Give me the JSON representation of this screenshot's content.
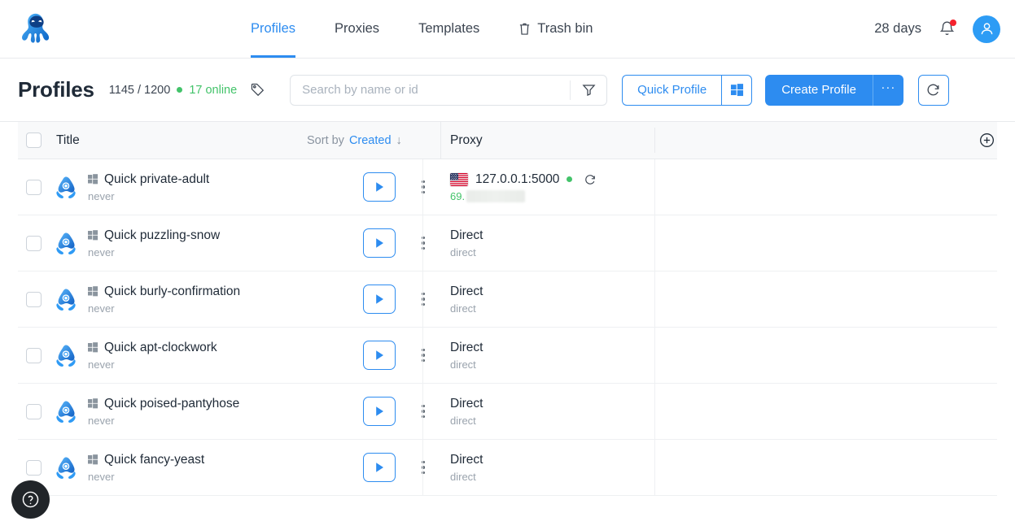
{
  "brand": {
    "logo_name": "octo-browser-logo",
    "accent": "#2d8cf0"
  },
  "header": {
    "nav": [
      {
        "label": "Profiles",
        "active": true,
        "icon": null
      },
      {
        "label": "Proxies",
        "active": false,
        "icon": null
      },
      {
        "label": "Templates",
        "active": false,
        "icon": null
      },
      {
        "label": "Trash bin",
        "active": false,
        "icon": "trash-icon"
      }
    ],
    "days_label": "28 days",
    "notifications_icon": "bell-icon",
    "has_notification_dot": true,
    "avatar_icon": "user-avatar-icon"
  },
  "subheader": {
    "title": "Profiles",
    "count": "1145 / 1200",
    "online": "17 online",
    "online_color": "#43c36a",
    "tag_icon": "tag-icon",
    "search": {
      "value": "",
      "placeholder": "Search by name or id",
      "filter_icon": "filter-icon"
    },
    "quick_profile_label": "Quick Profile",
    "quick_profile_os_icon": "windows-icon",
    "create_profile_label": "Create Profile",
    "create_more_label": "···",
    "refresh_icon": "refresh-icon"
  },
  "table": {
    "columns": {
      "title": "Title",
      "proxy": "Proxy"
    },
    "sort": {
      "prefix": "Sort by",
      "value": "Created",
      "direction": "↓"
    },
    "add_column_icon": "plus-circle-icon",
    "rows": [
      {
        "title": "Quick private-adult",
        "subtitle": "never",
        "os_icon": "windows-icon",
        "profile_icon": "octo-profile-icon",
        "proxy_main": "127.0.0.1:5000",
        "proxy_sub": "69.",
        "proxy_sub_redacted": true,
        "proxy_sub_green": true,
        "flag": "us-flag-icon",
        "has_status_dot": true,
        "has_proxy_refresh": true
      },
      {
        "title": "Quick puzzling-snow",
        "subtitle": "never",
        "os_icon": "windows-icon",
        "profile_icon": "octo-profile-icon",
        "proxy_main": "Direct",
        "proxy_sub": "direct",
        "proxy_sub_redacted": false,
        "proxy_sub_green": false,
        "flag": null,
        "has_status_dot": false,
        "has_proxy_refresh": false
      },
      {
        "title": "Quick burly-confirmation",
        "subtitle": "never",
        "os_icon": "windows-icon",
        "profile_icon": "octo-profile-icon",
        "proxy_main": "Direct",
        "proxy_sub": "direct",
        "proxy_sub_redacted": false,
        "proxy_sub_green": false,
        "flag": null,
        "has_status_dot": false,
        "has_proxy_refresh": false
      },
      {
        "title": "Quick apt-clockwork",
        "subtitle": "never",
        "os_icon": "windows-icon",
        "profile_icon": "octo-profile-icon",
        "proxy_main": "Direct",
        "proxy_sub": "direct",
        "proxy_sub_redacted": false,
        "proxy_sub_green": false,
        "flag": null,
        "has_status_dot": false,
        "has_proxy_refresh": false
      },
      {
        "title": "Quick poised-pantyhose",
        "subtitle": "never",
        "os_icon": "windows-icon",
        "profile_icon": "octo-profile-icon",
        "proxy_main": "Direct",
        "proxy_sub": "direct",
        "proxy_sub_redacted": false,
        "proxy_sub_green": false,
        "flag": null,
        "has_status_dot": false,
        "has_proxy_refresh": false
      },
      {
        "title": "Quick fancy-yeast",
        "subtitle": "never",
        "os_icon": "windows-icon",
        "profile_icon": "octo-profile-icon",
        "proxy_main": "Direct",
        "proxy_sub": "direct",
        "proxy_sub_redacted": false,
        "proxy_sub_green": false,
        "flag": null,
        "has_status_dot": false,
        "has_proxy_refresh": false
      }
    ]
  },
  "help": {
    "icon": "help-question-icon"
  }
}
